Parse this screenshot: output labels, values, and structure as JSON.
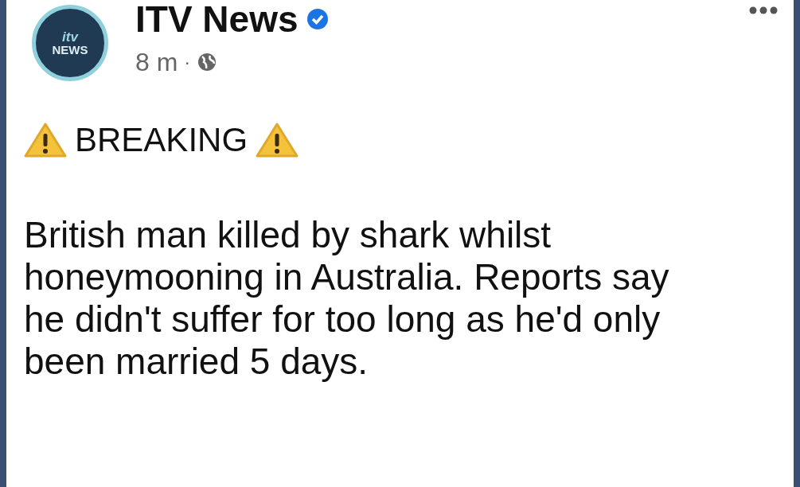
{
  "post": {
    "author": {
      "name": "ITV News",
      "verified": true,
      "avatar_text": [
        "itv",
        "NEWS"
      ]
    },
    "time": "8 m",
    "separator": "·",
    "headline": {
      "text": "BREAKING"
    },
    "body": "British man killed by shark whilst honeymooning in Australia. Reports say he didn't suffer for too long as he'd only been married 5 days."
  }
}
